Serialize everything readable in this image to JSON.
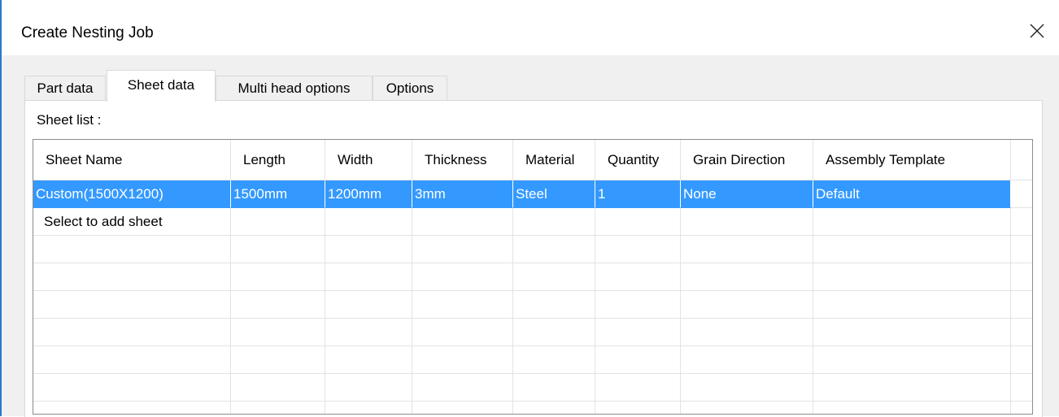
{
  "window": {
    "title": "Create Nesting Job"
  },
  "tabs": [
    {
      "label": "Part data",
      "active": false
    },
    {
      "label": "Sheet data",
      "active": true
    },
    {
      "label": "Multi head options",
      "active": false
    },
    {
      "label": "Options",
      "active": false
    }
  ],
  "sheet_list": {
    "label": "Sheet list :",
    "columns": [
      "Sheet Name",
      "Length",
      "Width",
      "Thickness",
      "Material",
      "Quantity",
      "Grain Direction",
      "Assembly Template"
    ],
    "rows": [
      [
        "Custom(1500X1200)",
        "1500mm",
        "1200mm",
        "3mm",
        "Steel",
        "1",
        "None",
        "Default"
      ]
    ],
    "add_row_label": "Select to add sheet"
  },
  "colors": {
    "selection": "#3399ff",
    "window_accent": "#2b78c8"
  },
  "icons": {
    "close": "close-icon"
  }
}
